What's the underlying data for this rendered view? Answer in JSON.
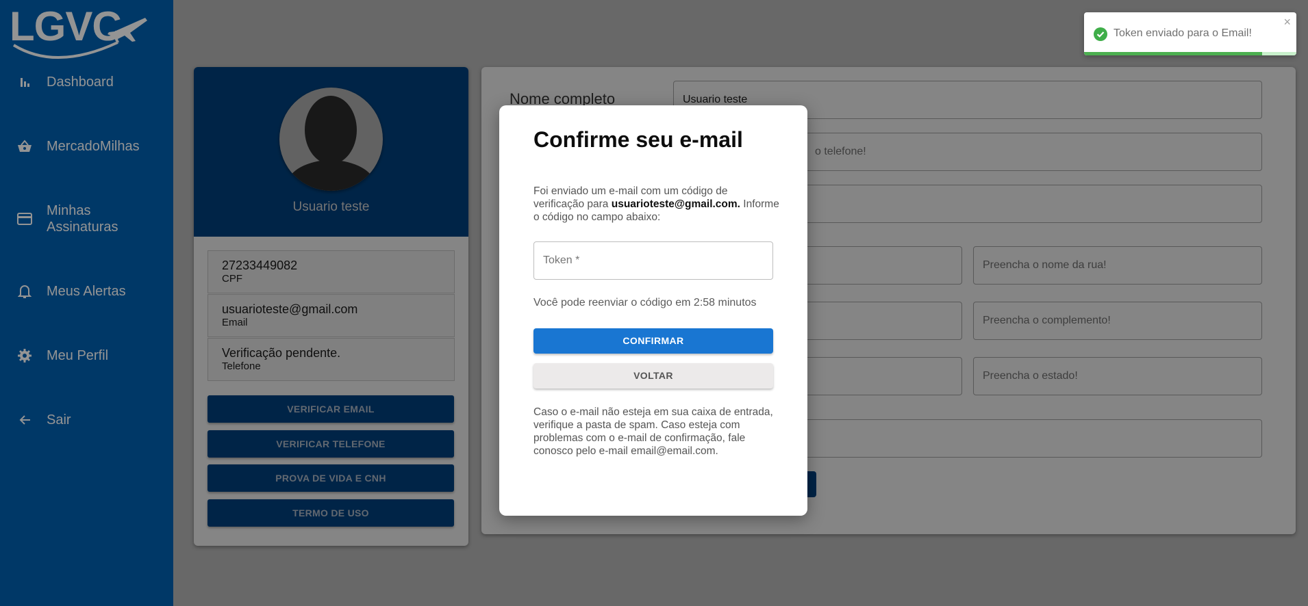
{
  "brand": {
    "logo_text": "LGVC"
  },
  "sidebar": {
    "items": [
      {
        "label": "Dashboard",
        "icon": "bar-chart-icon"
      },
      {
        "label": "MercadoMilhas",
        "icon": "basket-icon"
      },
      {
        "label": "Minhas Assinaturas",
        "icon": "credit-card-icon"
      },
      {
        "label": "Meus Alertas",
        "icon": "bell-icon"
      },
      {
        "label": "Meu Perfil",
        "icon": "gear-icon"
      },
      {
        "label": "Sair",
        "icon": "arrow-left-icon"
      }
    ]
  },
  "profile": {
    "name": "Usuario teste",
    "info": [
      {
        "value": "27233449082",
        "label": "CPF"
      },
      {
        "value": "usuarioteste@gmail.com",
        "label": "Email"
      },
      {
        "value": "Verificação pendente.",
        "label": "Telefone"
      }
    ],
    "buttons": [
      "VERIFICAR EMAIL",
      "VERIFICAR TELEFONE",
      "PROVA DE VIDA E CNH",
      "TERMO DE USO"
    ]
  },
  "form": {
    "name_label": "Nome completo",
    "name_value": "Usuario teste",
    "phone_placeholder_fragment": "o telefone!",
    "street_placeholder": "Preencha o nome da rua!",
    "complement_placeholder": "Preencha o complemento!",
    "state_placeholder": "Preencha o estado!"
  },
  "modal": {
    "title": "Confirme seu e-mail",
    "text_before": "Foi enviado um e-mail com um código de verificação para ",
    "email": "usuarioteste@gmail.com.",
    "text_after": " Informe o código no campo abaixo:",
    "token_placeholder": "Token *",
    "resend_text": "Você pode reenviar o código em 2:58 minutos",
    "confirm_label": "CONFIRMAR",
    "back_label": "VOLTAR",
    "footer_text": "Caso o e-mail não esteja em sua caixa de entrada, verifique a pasta de spam. Caso esteja com problemas com o e-mail de confirmação, fale conosco pelo e-mail email@email.com."
  },
  "toast": {
    "message": "Token enviado para o Email!",
    "close": "×",
    "progress": 0.84
  },
  "colors": {
    "sidebar": "#0061b1",
    "profile_header": "#003f7a",
    "primary_button": "#1976d2",
    "success": "#4caf50"
  }
}
